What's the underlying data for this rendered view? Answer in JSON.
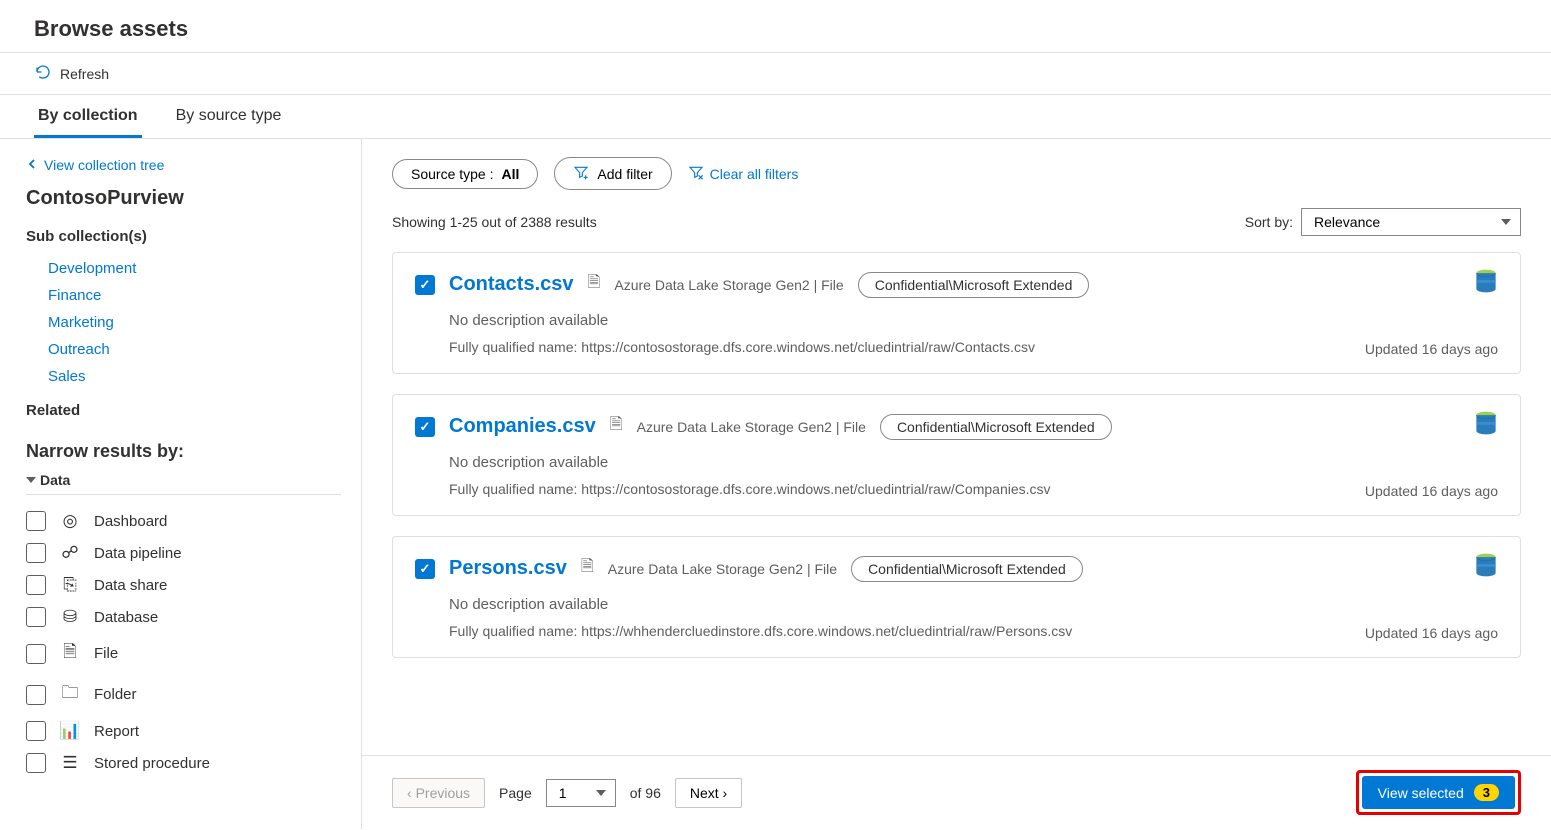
{
  "page": {
    "title": "Browse assets",
    "refresh": "Refresh"
  },
  "tabs": {
    "by_collection": "By collection",
    "by_source": "By source type"
  },
  "sidebar": {
    "view_tree": "View collection tree",
    "collection_name": "ContosoPurview",
    "sub_label": "Sub collection(s)",
    "related_label": "Related",
    "narrow_label": "Narrow results by:",
    "data_label": "Data",
    "subs": [
      "Development",
      "Finance",
      "Marketing",
      "Outreach",
      "Sales"
    ],
    "filters": [
      "Dashboard",
      "Data pipeline",
      "Data share",
      "Database",
      "File",
      "Folder",
      "Report",
      "Stored procedure"
    ]
  },
  "filterbar": {
    "source_label": "Source type : ",
    "source_value": "All",
    "add_filter": "Add filter",
    "clear_all": "Clear all filters"
  },
  "results": {
    "showing": "Showing 1-25 out of 2388 results",
    "sort_label": "Sort by:",
    "sort_value": "Relevance"
  },
  "items": [
    {
      "name": "Contacts.csv",
      "source": "Azure Data Lake Storage Gen2 | File",
      "tag": "Confidential\\Microsoft Extended",
      "nodesc": "No description available",
      "fqn": "Fully qualified name: https://contosostorage.dfs.core.windows.net/cluedintrial/raw/Contacts.csv",
      "updated": "Updated 16 days ago"
    },
    {
      "name": "Companies.csv",
      "source": "Azure Data Lake Storage Gen2 | File",
      "tag": "Confidential\\Microsoft Extended",
      "nodesc": "No description available",
      "fqn": "Fully qualified name: https://contosostorage.dfs.core.windows.net/cluedintrial/raw/Companies.csv",
      "updated": "Updated 16 days ago"
    },
    {
      "name": "Persons.csv",
      "source": "Azure Data Lake Storage Gen2 | File",
      "tag": "Confidential\\Microsoft Extended",
      "nodesc": "No description available",
      "fqn": "Fully qualified name: https://whhendercluedinstore.dfs.core.windows.net/cluedintrial/raw/Persons.csv",
      "updated": "Updated 16 days ago"
    }
  ],
  "pager": {
    "prev": "Previous",
    "page_label": "Page",
    "page_value": "1",
    "of_label": "of 96",
    "next": "Next",
    "view_selected": "View selected",
    "count": "3"
  }
}
